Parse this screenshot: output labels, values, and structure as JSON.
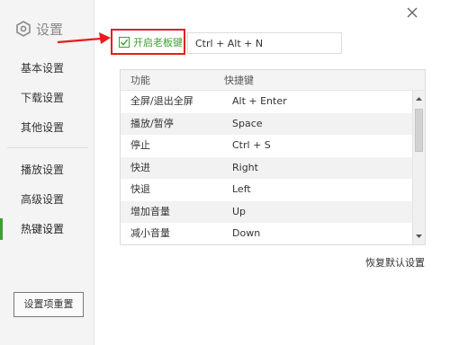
{
  "sidebar": {
    "title": "设置",
    "items": [
      {
        "label": "基本设置",
        "active": false
      },
      {
        "label": "下载设置",
        "active": false
      },
      {
        "label": "其他设置",
        "active": false
      },
      {
        "label": "播放设置",
        "active": false
      },
      {
        "label": "高级设置",
        "active": false
      },
      {
        "label": "热键设置",
        "active": true
      }
    ],
    "reset_button": "设置项重置"
  },
  "boss_key": {
    "label": "开启老板键",
    "checked": true,
    "hotkey_value": "Ctrl + Alt + N"
  },
  "table": {
    "columns": [
      "功能",
      "快捷键"
    ],
    "rows": [
      [
        "全屏/退出全屏",
        "Alt + Enter"
      ],
      [
        "播放/暂停",
        "Space"
      ],
      [
        "停止",
        "Ctrl + S"
      ],
      [
        "快进",
        "Right"
      ],
      [
        "快退",
        "Left"
      ],
      [
        "增加音量",
        "Up"
      ],
      [
        "减小音量",
        "Down"
      ]
    ]
  },
  "restore_defaults": "恢复默认设置",
  "colors": {
    "accent": "#3aa12e",
    "annotation": "#e51d1d"
  }
}
